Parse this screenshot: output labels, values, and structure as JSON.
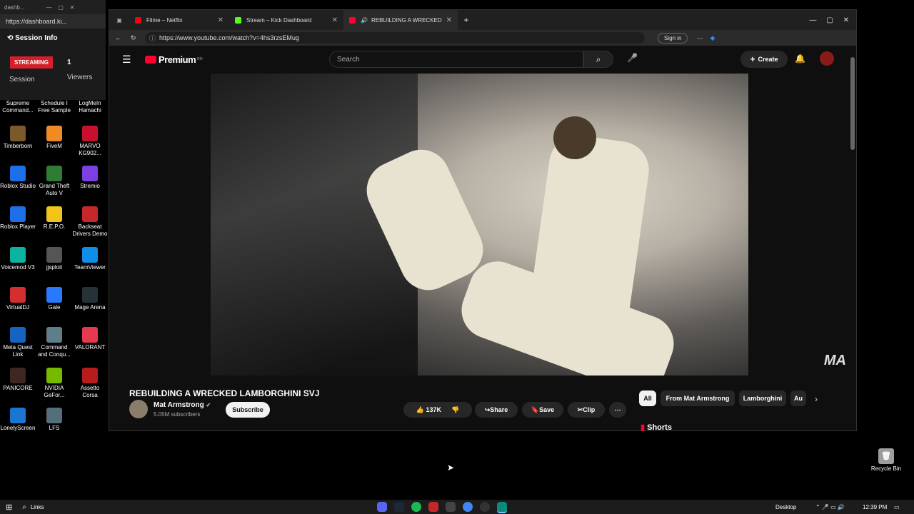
{
  "mini_window": {
    "title": "dashb...",
    "url": "https://dashboard.ki...",
    "session_info": "Session Info",
    "streaming": "STREAMING",
    "session_label": "Session",
    "viewers_count": "1",
    "viewers_label": "Viewers"
  },
  "desktop_icons": [
    {
      "label": "Supreme Command...",
      "color": "#444"
    },
    {
      "label": "Schedule I Free Sample",
      "color": "#555"
    },
    {
      "label": "LogMeIn Hamachi",
      "color": "#333"
    },
    {
      "label": "Timberborn",
      "color": "#7a5a2a"
    },
    {
      "label": "FiveM",
      "color": "#f08a24"
    },
    {
      "label": "MARVO KG902...",
      "color": "#c8102e"
    },
    {
      "label": "Roblox Studio",
      "color": "#1c6fe6"
    },
    {
      "label": "Grand Theft Auto V",
      "color": "#2e7d32"
    },
    {
      "label": "Stremio",
      "color": "#7b3fe4"
    },
    {
      "label": "Roblox Player",
      "color": "#1c6fe6"
    },
    {
      "label": "R.E.P.O.",
      "color": "#f0c419"
    },
    {
      "label": "Backseat Drivers Demo",
      "color": "#c62828"
    },
    {
      "label": "Voicemod V3",
      "color": "#0bb3a0"
    },
    {
      "label": "jjsploit",
      "color": "#555"
    },
    {
      "label": "TeamViewer",
      "color": "#0e8ee9"
    },
    {
      "label": "VirtualDJ",
      "color": "#d32f2f"
    },
    {
      "label": "Gale",
      "color": "#2979ff"
    },
    {
      "label": "Mage Arena",
      "color": "#263238"
    },
    {
      "label": "Meta Quest Link",
      "color": "#1565c0"
    },
    {
      "label": "Command and Conqu...",
      "color": "#607d8b"
    },
    {
      "label": "VALORANT",
      "color": "#e53950"
    },
    {
      "label": "PANICORE",
      "color": "#3e2723"
    },
    {
      "label": "NVIDIA GeFor...",
      "color": "#76b900"
    },
    {
      "label": "Assetto Corsa",
      "color": "#b71c1c"
    },
    {
      "label": "LonelyScreen",
      "color": "#1976d2"
    },
    {
      "label": "LFS",
      "color": "#546e7a"
    }
  ],
  "recycle_bin": "Recycle Bin",
  "tabs": [
    {
      "label": "Filme – Netflix",
      "color": "#e50914"
    },
    {
      "label": "Stream – Kick Dashboard",
      "color": "#53fc18"
    },
    {
      "label": "REBUILDING A WRECKED LA...",
      "color": "#ff0033"
    }
  ],
  "url": "https://www.youtube.com/watch?v=4hs3rzsEMug",
  "sign_in": "Sign in",
  "youtube": {
    "logo": "Premium",
    "logo_sup": "RO",
    "search_placeholder": "Search",
    "create": "Create",
    "watermark": "MA"
  },
  "video": {
    "title": "REBUILDING A WRECKED LAMBORGHINI SVJ",
    "channel": "Mat Armstrong",
    "subscribers": "5.05M subscribers",
    "subscribe": "Subscribe",
    "likes": "137K",
    "share": "Share",
    "save": "Save",
    "clip": "Clip"
  },
  "chips": [
    "All",
    "From Mat Armstrong",
    "Lamborghini",
    "Au"
  ],
  "shorts": "Shorts",
  "taskbar": {
    "search": "Links",
    "desktop": "Desktop",
    "time": "12:39 PM"
  }
}
